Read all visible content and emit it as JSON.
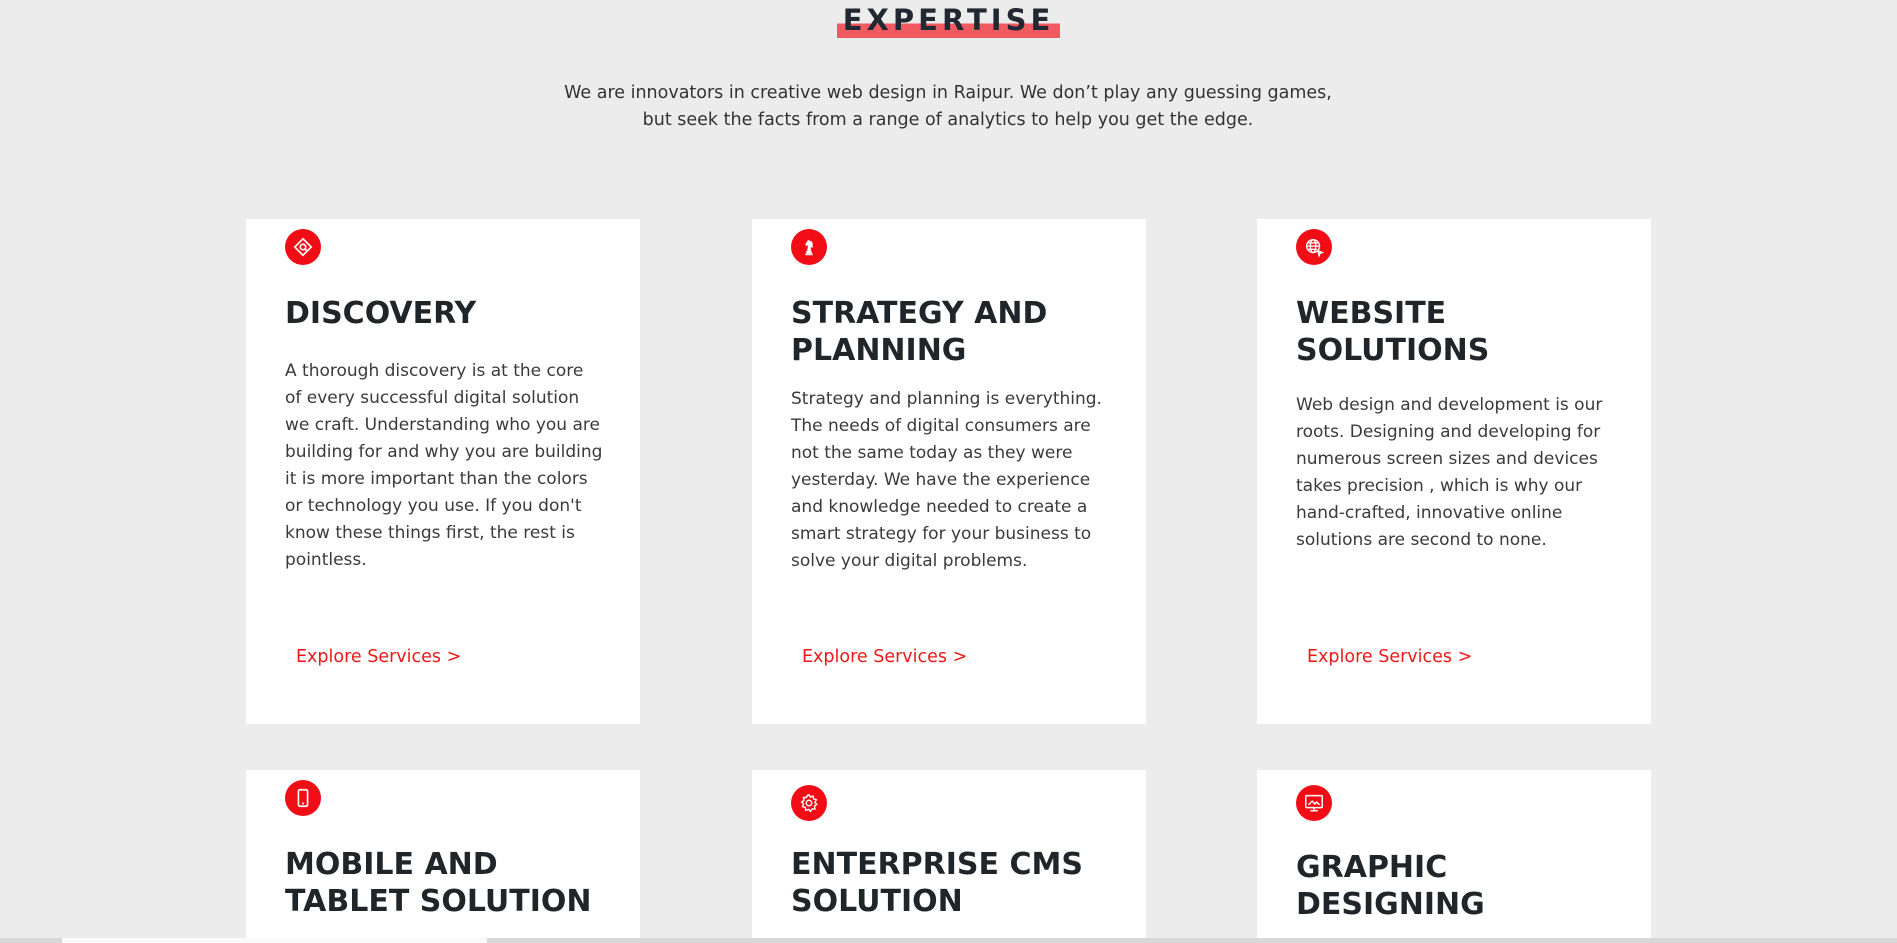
{
  "section": {
    "title": "EXPERTISE",
    "intro": "We are innovators in creative web design in Raipur. We don’t play any guessing games, but seek the facts from a range of analytics to help you get the edge."
  },
  "colors": {
    "accent": "#f20c16",
    "highlight": "#f25a62",
    "background": "#ececec"
  },
  "cards": [
    {
      "icon": "compass-target-icon",
      "title": "DISCOVERY",
      "text": "A thorough discovery is at the core of every successful digital solution we craft. Understanding who you are building for and why you are building it is more important than the colors or technology you use. If you don't know these things first, the rest is pointless.",
      "link": "Explore Services >"
    },
    {
      "icon": "chess-knight-icon",
      "title": "STRATEGY AND PLANNING",
      "text": "Strategy and planning is everything. The needs of digital consumers are not the same today as they were yesterday. We have the experience and knowledge needed to create a smart strategy for your business to solve your digital problems.",
      "link": "Explore Services >"
    },
    {
      "icon": "globe-cursor-icon",
      "title": "WEBSITE SOLUTIONS",
      "text": "Web design and development is our roots. Designing and developing for numerous screen sizes and devices takes precision , which is why our hand-crafted, innovative online solutions are second to none.",
      "link": "Explore Services >"
    },
    {
      "icon": "mobile-phone-icon",
      "title": "MOBILE AND TABLET SOLUTION"
    },
    {
      "icon": "gear-icon",
      "title": "ENTERPRISE CMS SOLUTION"
    },
    {
      "icon": "monitor-image-icon",
      "title": "GRAPHIC DESIGNING"
    }
  ]
}
